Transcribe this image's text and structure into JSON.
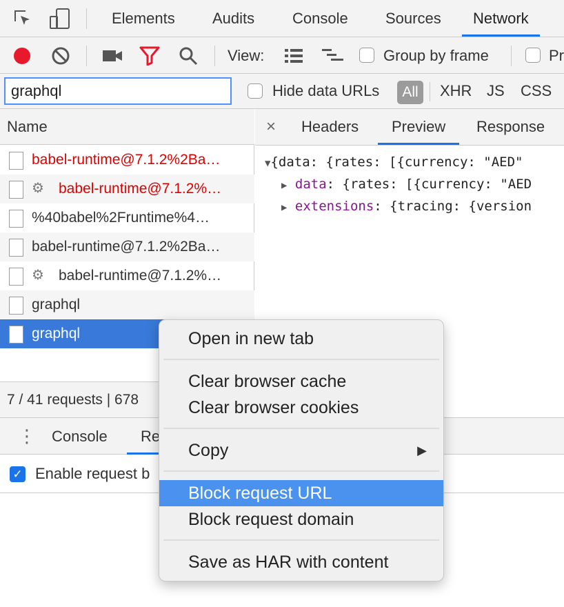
{
  "tabs": [
    "Elements",
    "Audits",
    "Console",
    "Sources",
    "Network"
  ],
  "toolbar": {
    "view_label": "View:",
    "group_by_frame": "Group by frame",
    "truncated_next": "Pr"
  },
  "filter": {
    "value": "graphql",
    "hide_data_urls": "Hide data URLs",
    "all": "All",
    "types": [
      "XHR",
      "JS",
      "CSS"
    ]
  },
  "requests": {
    "header": "Name",
    "rows": [
      "babel-runtime@7.1.2%2Ba…",
      "babel-runtime@7.1.2%…",
      "%40babel%2Fruntime%4…",
      "babel-runtime@7.1.2%2Ba…",
      "babel-runtime@7.1.2%…",
      "graphql",
      "graphql"
    ],
    "status": "7 / 41 requests | 678"
  },
  "detail": {
    "close": "×",
    "tabs": [
      "Headers",
      "Preview",
      "Response"
    ],
    "preview_lines": [
      "{data: {rates: [{currency: \"AED\"",
      "data: {rates: [{currency: \"AED",
      "extensions: {tracing: {version"
    ],
    "key_data": "data",
    "key_extensions": "extensions",
    "val_data": ": {rates: [{currency: \"AED",
    "val_extensions": ": {tracing: {version"
  },
  "drawer": {
    "tabs": [
      "Console",
      "Re"
    ],
    "enable_label": "Enable request b"
  },
  "context_menu": {
    "items": [
      "Open in new tab",
      "Clear browser cache",
      "Clear browser cookies",
      "Copy",
      "Block request URL",
      "Block request domain",
      "Save as HAR with content"
    ],
    "highlighted": "Block request URL"
  },
  "colors": {
    "accent": "#1a73e8",
    "selection": "#3879d9",
    "menu_highlight": "#4a92ee",
    "error_red": "#dd0000",
    "record_red": "#e8192c"
  }
}
